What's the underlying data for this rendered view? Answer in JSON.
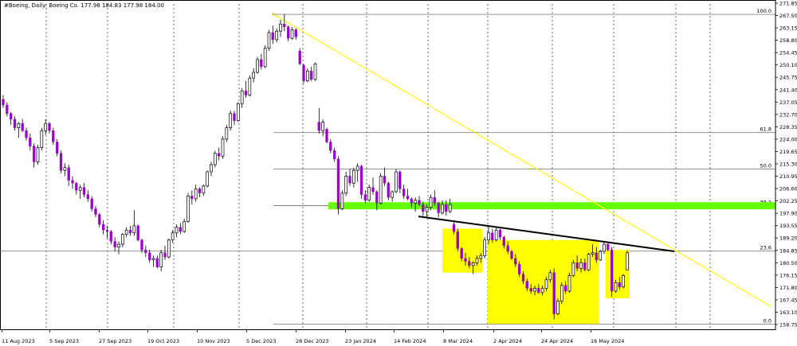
{
  "chart_data": {
    "type": "candlestick",
    "title": "#Boeing, Daily:  Boeing Co.  177.98 184.83 177.98 184.00",
    "symbol": "#Boeing",
    "timeframe": "Daily",
    "instrument": "Boeing Co.",
    "last_bar": {
      "open": 177.98,
      "high": 184.83,
      "low": 177.98,
      "close": 184.0
    },
    "y_axis_ticks": [
      "271.85",
      "267.50",
      "263.15",
      "258.80",
      "254.45",
      "250.10",
      "245.75",
      "241.40",
      "237.05",
      "232.70",
      "228.35",
      "224.00",
      "219.65",
      "215.30",
      "210.95",
      "206.60",
      "202.25",
      "197.90",
      "193.55",
      "189.20",
      "184.85",
      "180.50",
      "176.15",
      "171.80",
      "167.45",
      "163.10",
      "158.75"
    ],
    "ylim": [
      158.75,
      271.85
    ],
    "x_axis_ticks": [
      "11 Aug 2023",
      "5 Sep 2023",
      "27 Sep 2023",
      "19 Oct 2023",
      "10 Nov 2023",
      "5 Dec 2023",
      "28 Dec 2023",
      "23 Jan 2024",
      "14 Feb 2024",
      "8 Mar 2024",
      "2 Apr 2024",
      "24 Apr 2024",
      "16 May 2024"
    ],
    "fibonacci": {
      "levels": [
        {
          "label": "100.0",
          "price": 267.9
        },
        {
          "label": "61.8",
          "price": 226.3
        },
        {
          "label": "50.0",
          "price": 213.5
        },
        {
          "label": "38.2",
          "price": 200.6
        },
        {
          "label": "23.6",
          "price": 184.6
        },
        {
          "label": "0.0",
          "price": 158.9
        }
      ]
    },
    "support_zone": {
      "from": 199.3,
      "to": 201.8,
      "color": "#66ff00"
    },
    "trendlines": [
      {
        "color": "#000000",
        "from_price": 196.8,
        "to_price": 184.5
      },
      {
        "color": "#ffff00",
        "from_price": 268.0,
        "to_price": 165.0
      }
    ],
    "highlight_boxes_color": "#ffff00",
    "colors": {
      "up_body": "#ffffff",
      "down_body": "#9900cc",
      "wick": "#000000",
      "grid": "#000000"
    },
    "candles": [
      [
        238.0,
        239.5,
        235.0,
        236.0
      ],
      [
        236.0,
        237.0,
        232.0,
        233.0
      ],
      [
        233.0,
        233.5,
        229.0,
        231.0
      ],
      [
        231.0,
        232.0,
        227.0,
        228.0
      ],
      [
        228.0,
        230.0,
        224.5,
        229.5
      ],
      [
        229.5,
        231.0,
        226.5,
        227.0
      ],
      [
        227.0,
        228.0,
        223.5,
        224.5
      ],
      [
        224.5,
        226.0,
        220.0,
        221.5
      ],
      [
        221.5,
        222.5,
        214.0,
        216.0
      ],
      [
        216.0,
        222.0,
        215.0,
        221.0
      ],
      [
        221.0,
        228.0,
        220.0,
        227.0
      ],
      [
        227.0,
        231.0,
        225.5,
        229.5
      ],
      [
        229.5,
        230.0,
        226.0,
        227.0
      ],
      [
        227.0,
        228.0,
        222.0,
        223.0
      ],
      [
        223.0,
        224.0,
        218.0,
        219.0
      ],
      [
        219.0,
        220.0,
        212.0,
        213.0
      ],
      [
        213.0,
        215.5,
        211.0,
        214.0
      ],
      [
        214.0,
        215.0,
        207.5,
        209.5
      ],
      [
        209.5,
        211.0,
        206.5,
        208.5
      ],
      [
        208.5,
        209.0,
        204.5,
        206.0
      ],
      [
        206.0,
        208.0,
        203.0,
        207.0
      ],
      [
        207.0,
        208.5,
        203.5,
        204.5
      ],
      [
        204.5,
        206.0,
        202.0,
        203.0
      ],
      [
        203.0,
        204.0,
        198.5,
        199.5
      ],
      [
        199.5,
        200.5,
        196.5,
        197.5
      ],
      [
        197.5,
        198.0,
        193.0,
        194.0
      ],
      [
        194.0,
        195.5,
        190.5,
        192.0
      ],
      [
        192.0,
        193.5,
        189.0,
        191.5
      ],
      [
        191.5,
        192.0,
        187.0,
        188.0
      ],
      [
        188.0,
        189.5,
        184.5,
        186.0
      ],
      [
        186.0,
        188.0,
        183.5,
        187.0
      ],
      [
        187.0,
        191.0,
        186.0,
        190.5
      ],
      [
        190.5,
        193.0,
        189.5,
        192.0
      ],
      [
        192.0,
        193.5,
        190.0,
        191.0
      ],
      [
        191.0,
        199.0,
        190.0,
        193.5
      ],
      [
        193.5,
        194.0,
        188.0,
        188.5
      ],
      [
        188.5,
        189.0,
        184.0,
        185.0
      ],
      [
        185.0,
        186.5,
        182.5,
        184.0
      ],
      [
        184.0,
        185.0,
        180.5,
        181.5
      ],
      [
        181.5,
        183.0,
        179.0,
        182.0
      ],
      [
        182.0,
        183.0,
        178.5,
        179.0
      ],
      [
        179.0,
        185.0,
        177.5,
        184.0
      ],
      [
        184.0,
        186.5,
        181.5,
        182.5
      ],
      [
        182.5,
        189.0,
        182.0,
        188.5
      ],
      [
        188.5,
        192.0,
        187.5,
        191.0
      ],
      [
        191.0,
        194.0,
        189.5,
        193.0
      ],
      [
        193.0,
        194.5,
        190.5,
        191.5
      ],
      [
        191.5,
        196.0,
        191.0,
        195.0
      ],
      [
        195.0,
        205.0,
        194.5,
        204.0
      ],
      [
        204.0,
        206.0,
        201.0,
        203.0
      ],
      [
        203.0,
        208.0,
        202.0,
        206.5
      ],
      [
        206.5,
        207.0,
        203.5,
        205.0
      ],
      [
        205.0,
        208.0,
        204.0,
        207.5
      ],
      [
        207.5,
        213.0,
        207.0,
        212.5
      ],
      [
        212.5,
        216.0,
        211.0,
        215.0
      ],
      [
        215.0,
        220.0,
        214.0,
        219.0
      ],
      [
        219.0,
        221.0,
        216.5,
        218.0
      ],
      [
        218.0,
        225.0,
        217.0,
        224.0
      ],
      [
        224.0,
        229.0,
        223.0,
        228.0
      ],
      [
        228.0,
        234.0,
        227.0,
        233.0
      ],
      [
        233.0,
        234.0,
        229.0,
        230.5
      ],
      [
        230.5,
        237.0,
        230.0,
        236.5
      ],
      [
        236.5,
        242.0,
        235.0,
        241.0
      ],
      [
        241.0,
        244.5,
        238.5,
        239.5
      ],
      [
        239.5,
        246.5,
        239.0,
        245.5
      ],
      [
        245.5,
        249.0,
        244.0,
        247.5
      ],
      [
        247.5,
        253.0,
        247.0,
        252.0
      ],
      [
        252.0,
        254.0,
        248.5,
        249.5
      ],
      [
        249.5,
        257.0,
        249.0,
        256.0
      ],
      [
        256.0,
        262.5,
        255.0,
        261.5
      ],
      [
        261.5,
        264.0,
        257.5,
        259.0
      ],
      [
        259.0,
        263.0,
        258.0,
        262.0
      ],
      [
        262.0,
        266.0,
        260.0,
        264.5
      ],
      [
        264.5,
        267.9,
        262.0,
        263.5
      ],
      [
        263.5,
        264.0,
        258.5,
        259.5
      ],
      [
        259.5,
        263.5,
        259.0,
        262.5
      ],
      [
        262.5,
        263.0,
        259.0,
        260.0
      ],
      [
        255.0,
        256.0,
        250.0,
        250.5
      ],
      [
        250.0,
        250.5,
        243.5,
        244.5
      ],
      [
        244.5,
        249.0,
        244.0,
        248.0
      ],
      [
        248.0,
        249.5,
        244.5,
        245.0
      ],
      [
        245.0,
        251.0,
        244.5,
        250.5
      ],
      [
        230.0,
        235.0,
        226.0,
        227.0
      ],
      [
        227.0,
        231.0,
        225.0,
        230.0
      ],
      [
        227.5,
        228.0,
        222.5,
        223.0
      ],
      [
        223.0,
        224.0,
        219.0,
        220.0
      ],
      [
        220.0,
        221.0,
        216.0,
        217.0
      ],
      [
        217.0,
        218.0,
        197.5,
        199.5
      ],
      [
        199.5,
        206.0,
        199.0,
        205.0
      ],
      [
        205.0,
        212.5,
        204.0,
        211.0
      ],
      [
        211.0,
        213.5,
        207.5,
        208.5
      ],
      [
        208.5,
        214.0,
        207.0,
        213.0
      ],
      [
        213.0,
        215.5,
        209.0,
        214.5
      ],
      [
        214.5,
        215.0,
        203.0,
        204.5
      ],
      [
        204.5,
        206.0,
        201.5,
        202.5
      ],
      [
        202.5,
        208.0,
        202.0,
        207.0
      ],
      [
        207.0,
        210.5,
        204.5,
        205.5
      ],
      [
        205.5,
        206.0,
        199.0,
        201.5
      ],
      [
        201.5,
        212.0,
        201.0,
        211.0
      ],
      [
        211.0,
        214.0,
        207.5,
        208.5
      ],
      [
        208.5,
        209.0,
        202.5,
        203.5
      ],
      [
        203.5,
        206.0,
        202.0,
        205.5
      ],
      [
        205.5,
        213.5,
        205.0,
        212.5
      ],
      [
        212.5,
        213.0,
        205.0,
        206.5
      ],
      [
        206.5,
        208.0,
        203.0,
        204.0
      ],
      [
        204.0,
        206.5,
        202.5,
        203.0
      ],
      [
        203.0,
        203.5,
        200.0,
        201.5
      ],
      [
        201.5,
        203.5,
        198.5,
        202.5
      ],
      [
        202.5,
        204.0,
        200.5,
        201.0
      ],
      [
        201.0,
        202.0,
        197.0,
        198.5
      ],
      [
        198.5,
        201.0,
        196.5,
        200.0
      ],
      [
        200.0,
        204.5,
        199.0,
        203.5
      ],
      [
        203.5,
        206.0,
        200.5,
        201.5
      ],
      [
        201.5,
        202.0,
        196.5,
        198.0
      ],
      [
        198.0,
        202.5,
        197.5,
        201.0
      ],
      [
        201.0,
        202.5,
        197.0,
        198.5
      ],
      [
        198.5,
        203.0,
        198.0,
        201.0
      ],
      [
        194.0,
        195.0,
        190.5,
        191.5
      ],
      [
        191.5,
        192.5,
        184.5,
        185.5
      ],
      [
        185.5,
        186.0,
        181.0,
        182.0
      ],
      [
        182.0,
        184.0,
        179.5,
        181.0
      ],
      [
        181.0,
        182.5,
        178.5,
        179.5
      ],
      [
        179.5,
        181.0,
        176.5,
        180.5
      ],
      [
        180.5,
        183.0,
        179.5,
        182.0
      ],
      [
        182.0,
        184.0,
        180.5,
        183.0
      ],
      [
        183.0,
        189.5,
        182.0,
        188.5
      ],
      [
        188.5,
        193.0,
        187.0,
        191.0
      ],
      [
        191.0,
        192.5,
        187.5,
        188.5
      ],
      [
        188.5,
        193.0,
        188.0,
        192.0
      ],
      [
        192.0,
        192.5,
        188.5,
        189.5
      ],
      [
        189.5,
        190.0,
        185.5,
        186.5
      ],
      [
        186.5,
        188.0,
        183.5,
        184.5
      ],
      [
        184.5,
        185.0,
        181.5,
        182.0
      ],
      [
        182.0,
        183.5,
        179.0,
        180.0
      ],
      [
        180.0,
        181.0,
        175.5,
        176.5
      ],
      [
        176.5,
        177.5,
        173.0,
        174.0
      ],
      [
        174.0,
        175.0,
        170.5,
        171.5
      ],
      [
        171.5,
        173.0,
        169.5,
        170.5
      ],
      [
        170.5,
        172.5,
        169.0,
        171.5
      ],
      [
        171.5,
        173.0,
        169.5,
        170.0
      ],
      [
        170.0,
        172.5,
        169.0,
        171.5
      ],
      [
        171.5,
        175.5,
        170.5,
        174.5
      ],
      [
        174.5,
        178.0,
        173.5,
        177.0
      ],
      [
        177.0,
        178.5,
        160.5,
        162.5
      ],
      [
        162.5,
        168.0,
        162.0,
        167.0
      ],
      [
        167.0,
        173.5,
        166.0,
        172.5
      ],
      [
        172.5,
        174.0,
        169.5,
        170.5
      ],
      [
        170.5,
        177.0,
        170.0,
        176.0
      ],
      [
        176.0,
        181.5,
        175.5,
        180.5
      ],
      [
        180.5,
        183.0,
        177.5,
        178.5
      ],
      [
        178.5,
        182.0,
        177.0,
        180.5
      ],
      [
        180.5,
        182.0,
        177.5,
        178.0
      ],
      [
        178.0,
        184.0,
        177.5,
        183.5
      ],
      [
        183.5,
        187.0,
        182.5,
        184.0
      ],
      [
        184.0,
        186.0,
        180.5,
        181.5
      ],
      [
        181.5,
        185.0,
        181.0,
        184.5
      ],
      [
        184.5,
        188.0,
        183.5,
        187.0
      ],
      [
        187.0,
        188.0,
        184.5,
        185.0
      ],
      [
        185.0,
        186.0,
        168.5,
        170.5
      ],
      [
        170.5,
        174.5,
        170.0,
        173.5
      ],
      [
        173.5,
        175.5,
        171.0,
        172.0
      ],
      [
        172.0,
        176.5,
        171.5,
        176.0
      ],
      [
        177.98,
        184.83,
        177.98,
        184.0
      ]
    ]
  }
}
